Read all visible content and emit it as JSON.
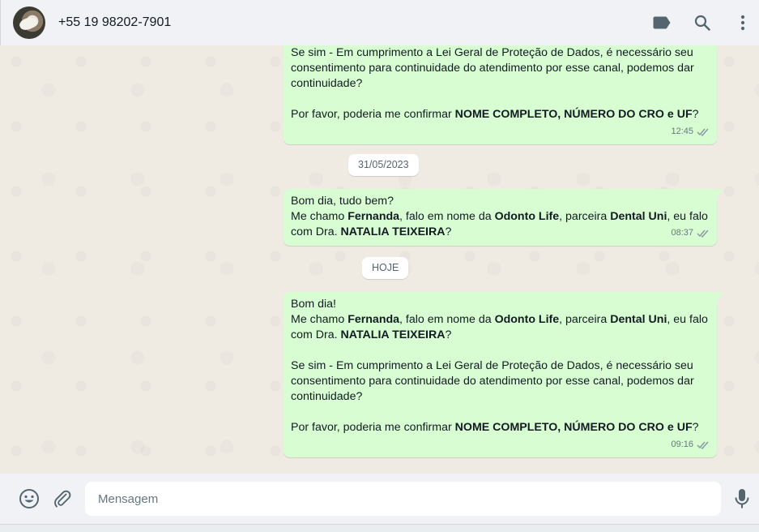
{
  "header": {
    "contact_name": "+55 19 98202-7901",
    "icons": [
      "label-icon",
      "search-icon",
      "menu-icon"
    ]
  },
  "messages": [
    {
      "time": "12:45",
      "status": "read",
      "p1": "Se sim - Em cumprimento a Lei Geral de Proteção de Dados, é necessário seu consentimento para continuidade do atendimento por esse canal, podemos dar continuidade?",
      "p2_pre": "Por favor, poderia me confirmar ",
      "p2_bold": "NOME COMPLETO, NÚMERO DO CRO e UF",
      "p2_post": "?"
    },
    {
      "time": "08:37",
      "status": "read",
      "greeting": "Bom dia, tudo bem?",
      "intro_1": "Me chamo ",
      "name": "Fernanda",
      "intro_2": ", falo em nome da ",
      "company": "Odonto Life",
      "intro_3": ", parceira ",
      "partner": "Dental Uni",
      "intro_4": ", eu falo com Dra. ",
      "doctor": "NATALIA TEIXEIRA",
      "intro_5": "?"
    },
    {
      "time": "09:16",
      "status": "read",
      "greeting": "Bom dia!",
      "intro_1": "Me chamo ",
      "name": "Fernanda",
      "intro_2": ", falo em nome da ",
      "company": "Odonto Life",
      "intro_3": ", parceira ",
      "partner": "Dental Uni",
      "intro_4": ", eu falo com Dra. ",
      "doctor": "NATALIA TEIXEIRA",
      "intro_5": "?",
      "p1": "Se sim - Em cumprimento a Lei Geral de Proteção de Dados, é necessário seu consentimento para continuidade do atendimento por esse canal, podemos dar continuidade?",
      "p2_pre": "Por favor, poderia me confirmar ",
      "p2_bold": "NOME COMPLETO, NÚMERO DO CRO e UF",
      "p2_post": "?"
    }
  ],
  "date_separators": [
    "31/05/2023",
    "HOJE"
  ],
  "composer": {
    "placeholder": "Mensagem",
    "icons": [
      "emoji-icon",
      "attach-icon",
      "mic-icon"
    ]
  },
  "colors": {
    "outgoing_bubble": "#d9fdd3",
    "header_bg": "#f0f2f5",
    "chat_bg": "#efeae2",
    "read_ticks": "#8696a0"
  }
}
